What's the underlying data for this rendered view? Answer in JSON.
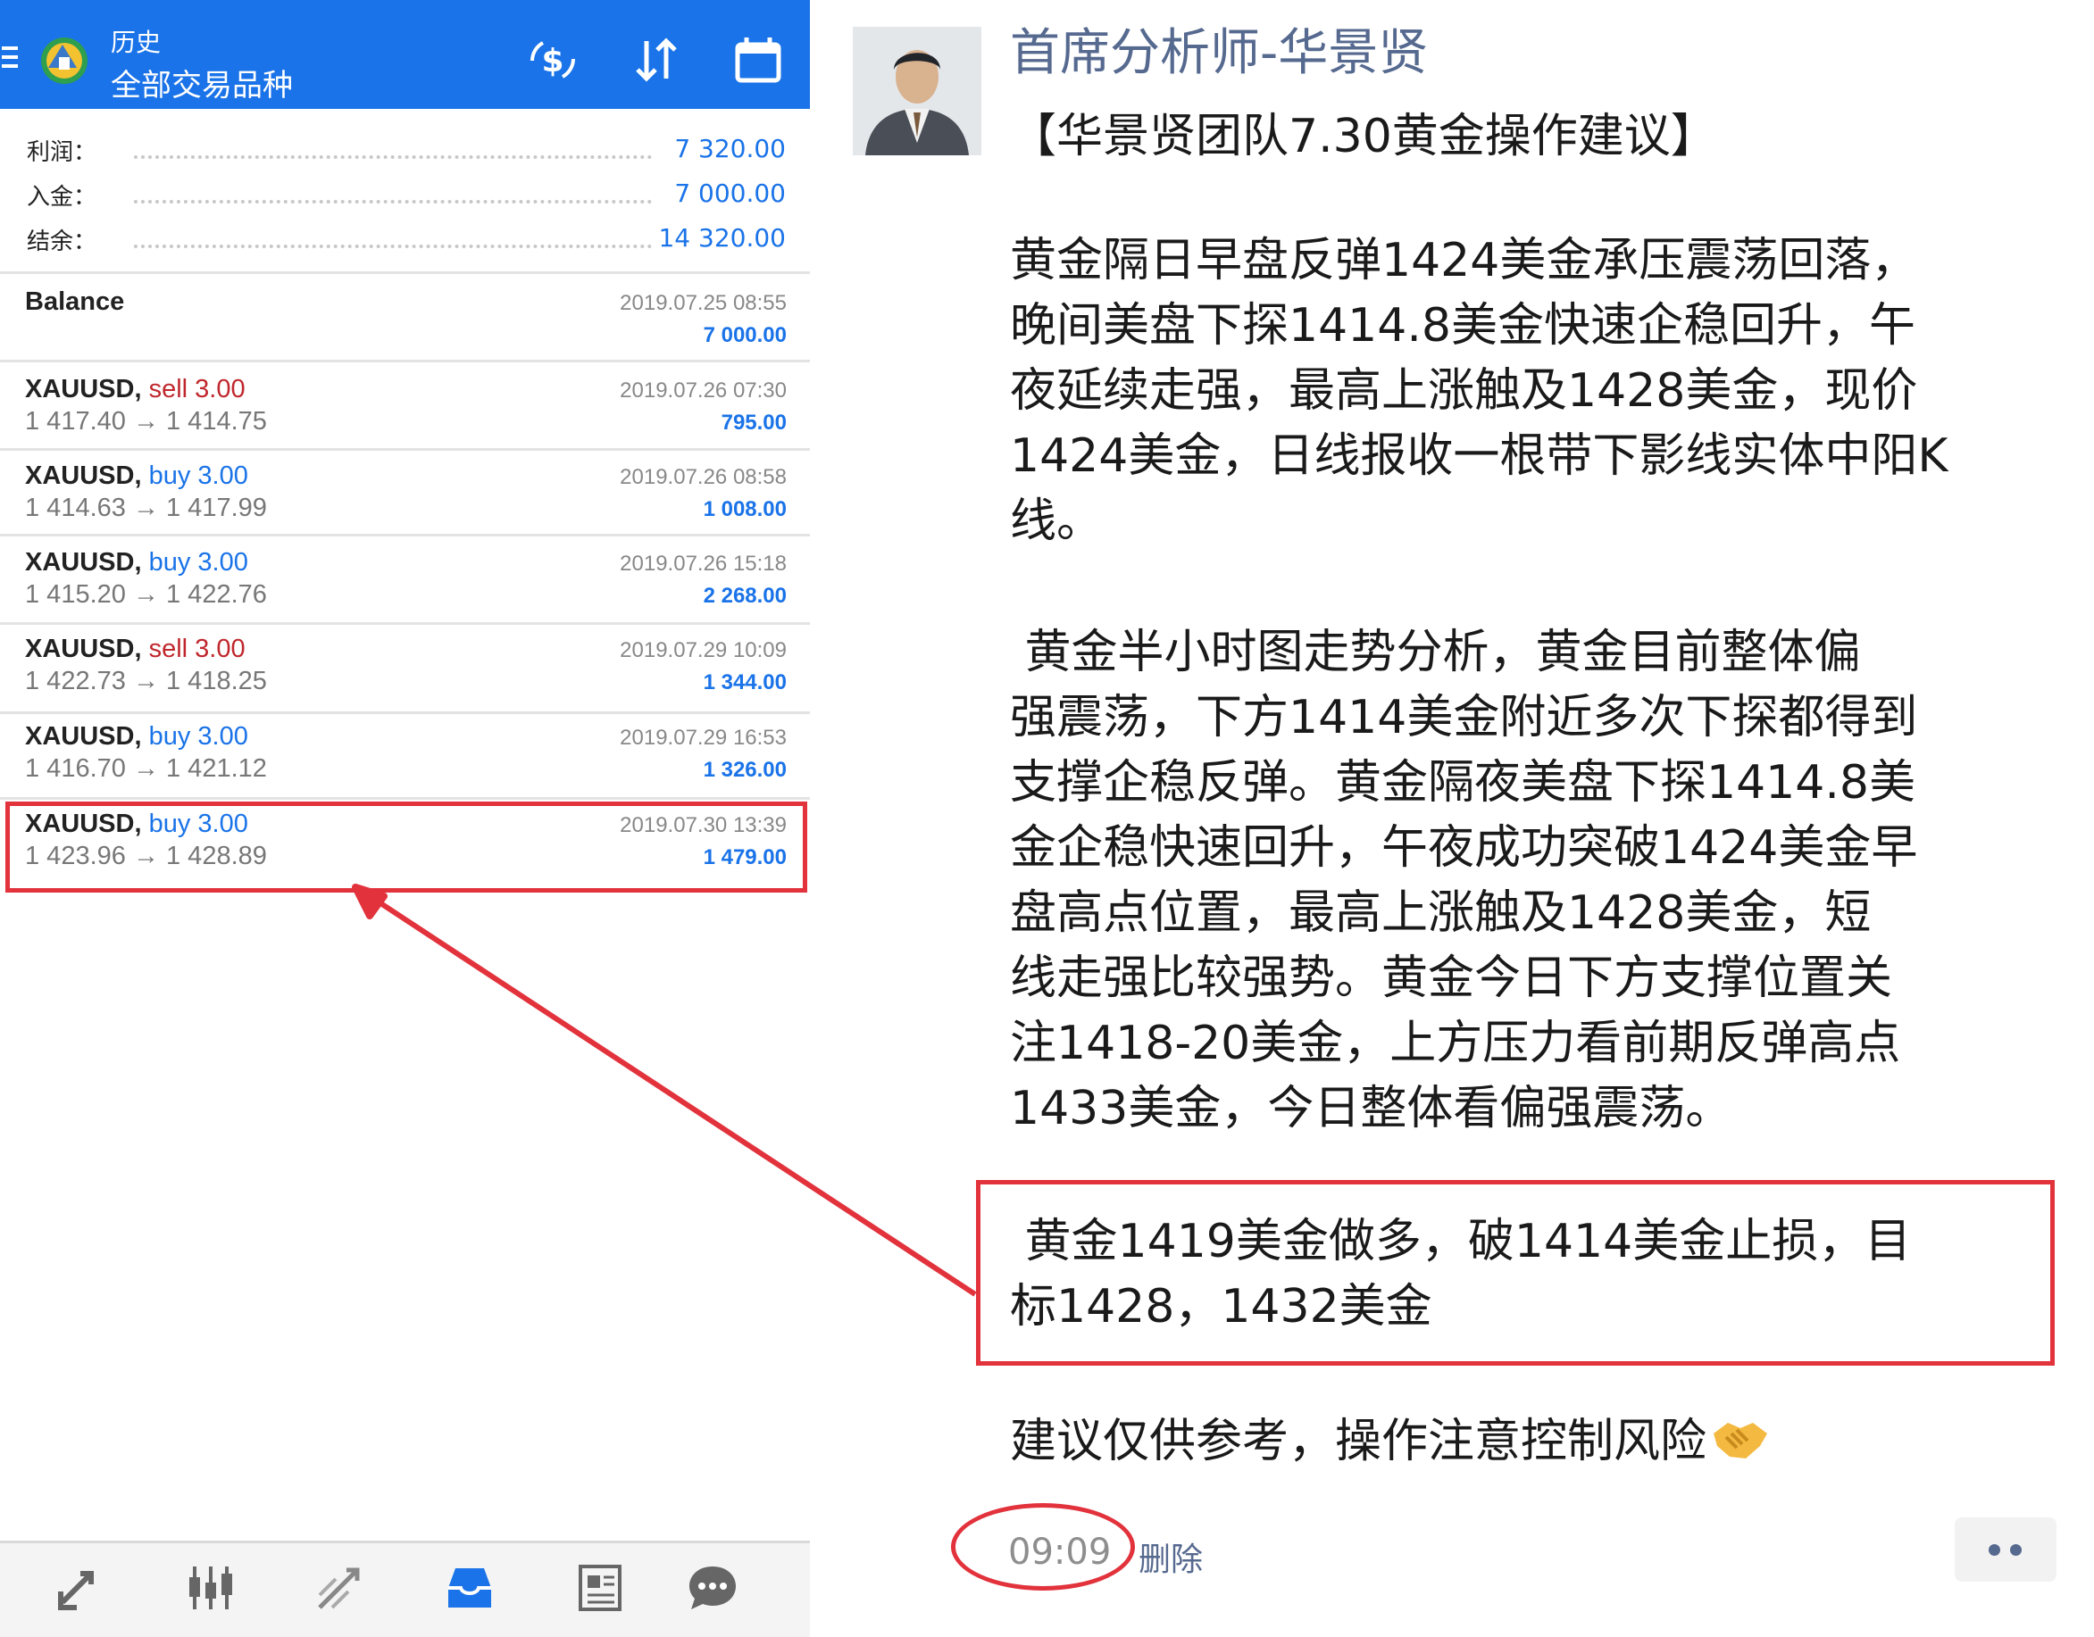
{
  "app": {
    "header": {
      "title": "历史",
      "subtitle": "全部交易品种"
    },
    "summary": [
      {
        "label": "利润：",
        "value": "7 320.00"
      },
      {
        "label": "入金：",
        "value": "7 000.00"
      },
      {
        "label": "结余：",
        "value": "14 320.00"
      }
    ],
    "balance": {
      "label": "Balance",
      "datetime": "2019.07.25 08:55",
      "amount": "7 000.00"
    },
    "deals": [
      {
        "symbol": "XAUUSD,",
        "type": "sell",
        "volume": "3.00",
        "prices": "1 417.40 → 1 414.75",
        "datetime": "2019.07.26 07:30",
        "profit": "795.00"
      },
      {
        "symbol": "XAUUSD,",
        "type": "buy",
        "volume": "3.00",
        "prices": "1 414.63 → 1 417.99",
        "datetime": "2019.07.26 08:58",
        "profit": "1 008.00"
      },
      {
        "symbol": "XAUUSD,",
        "type": "buy",
        "volume": "3.00",
        "prices": "1 415.20 → 1 422.76",
        "datetime": "2019.07.26 15:18",
        "profit": "2 268.00"
      },
      {
        "symbol": "XAUUSD,",
        "type": "sell",
        "volume": "3.00",
        "prices": "1 422.73 → 1 418.25",
        "datetime": "2019.07.29 10:09",
        "profit": "1 344.00"
      },
      {
        "symbol": "XAUUSD,",
        "type": "buy",
        "volume": "3.00",
        "prices": "1 416.70 → 1 421.12",
        "datetime": "2019.07.29 16:53",
        "profit": "1 326.00"
      },
      {
        "symbol": "XAUUSD,",
        "type": "buy",
        "volume": "3.00",
        "prices": "1 423.96 → 1 428.89",
        "datetime": "2019.07.30 13:39",
        "profit": "1 479.00"
      }
    ],
    "toolbar_icons": [
      "quotes-icon",
      "chart-icon",
      "trade-icon",
      "history-icon",
      "news-icon",
      "chat-icon"
    ],
    "colors": {
      "header": "#1a73e8",
      "sell": "#c0272d",
      "buy": "#1a73e8",
      "highlight": "#e2323c"
    }
  },
  "post": {
    "author": "首席分析师-华景贤",
    "title": "【华景贤团队7.30黄金操作建议】",
    "paragraph1": "黄金隔日早盘反弹1424美金承压震荡回落，\n晚间美盘下探1414.8美金快速企稳回升，午\n夜延续走强，最高上涨触及1428美金，现价\n1424美金，日线报收一根带下影线实体中阳K\n线。",
    "paragraph2": " 黄金半小时图走势分析，黄金目前整体偏\n强震荡，下方1414美金附近多次下探都得到\n支撑企稳反弹。黄金隔夜美盘下探1414.8美\n金企稳快速回升，午夜成功突破1424美金早\n盘高点位置，最高上涨触及1428美金，短\n线走强比较强势。黄金今日下方支撑位置关\n注1418-20美金，上方压力看前期反弹高点\n1433美金，今日整体看偏强震荡。",
    "recommendation": " 黄金1419美金做多，破1414美金止损，目\n标1428，1432美金",
    "closing": "建议仅供参考，操作注意控制风险",
    "closing_emoji": "handshake-icon",
    "time": "09:09",
    "delete_label": "删除",
    "colors": {
      "author": "#56698f",
      "text": "#1a1a1a"
    }
  }
}
